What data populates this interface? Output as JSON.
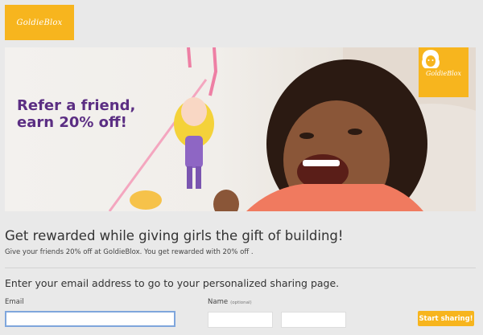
{
  "brand": {
    "logo_text": "GoldieBlox",
    "badge_text": "GoldieBlox"
  },
  "hero": {
    "headline_line1": "Refer a friend,",
    "headline_line2": "earn 20% off!"
  },
  "main": {
    "title": "Get rewarded while giving girls the gift of building!",
    "subtitle": "Give your friends 20% off at GoldieBlox. You get rewarded with 20% off .",
    "form_heading": "Enter your email address to go to your personalized sharing page."
  },
  "form": {
    "email_label": "Email",
    "email_value": "",
    "name_label": "Name",
    "name_hint": "(optional)",
    "first_name_value": "",
    "last_name_value": "",
    "submit_label": "Start sharing!"
  },
  "colors": {
    "brand_yellow": "#f7b51e",
    "headline_purple": "#5b2e83",
    "background": "#e9e9e9"
  }
}
